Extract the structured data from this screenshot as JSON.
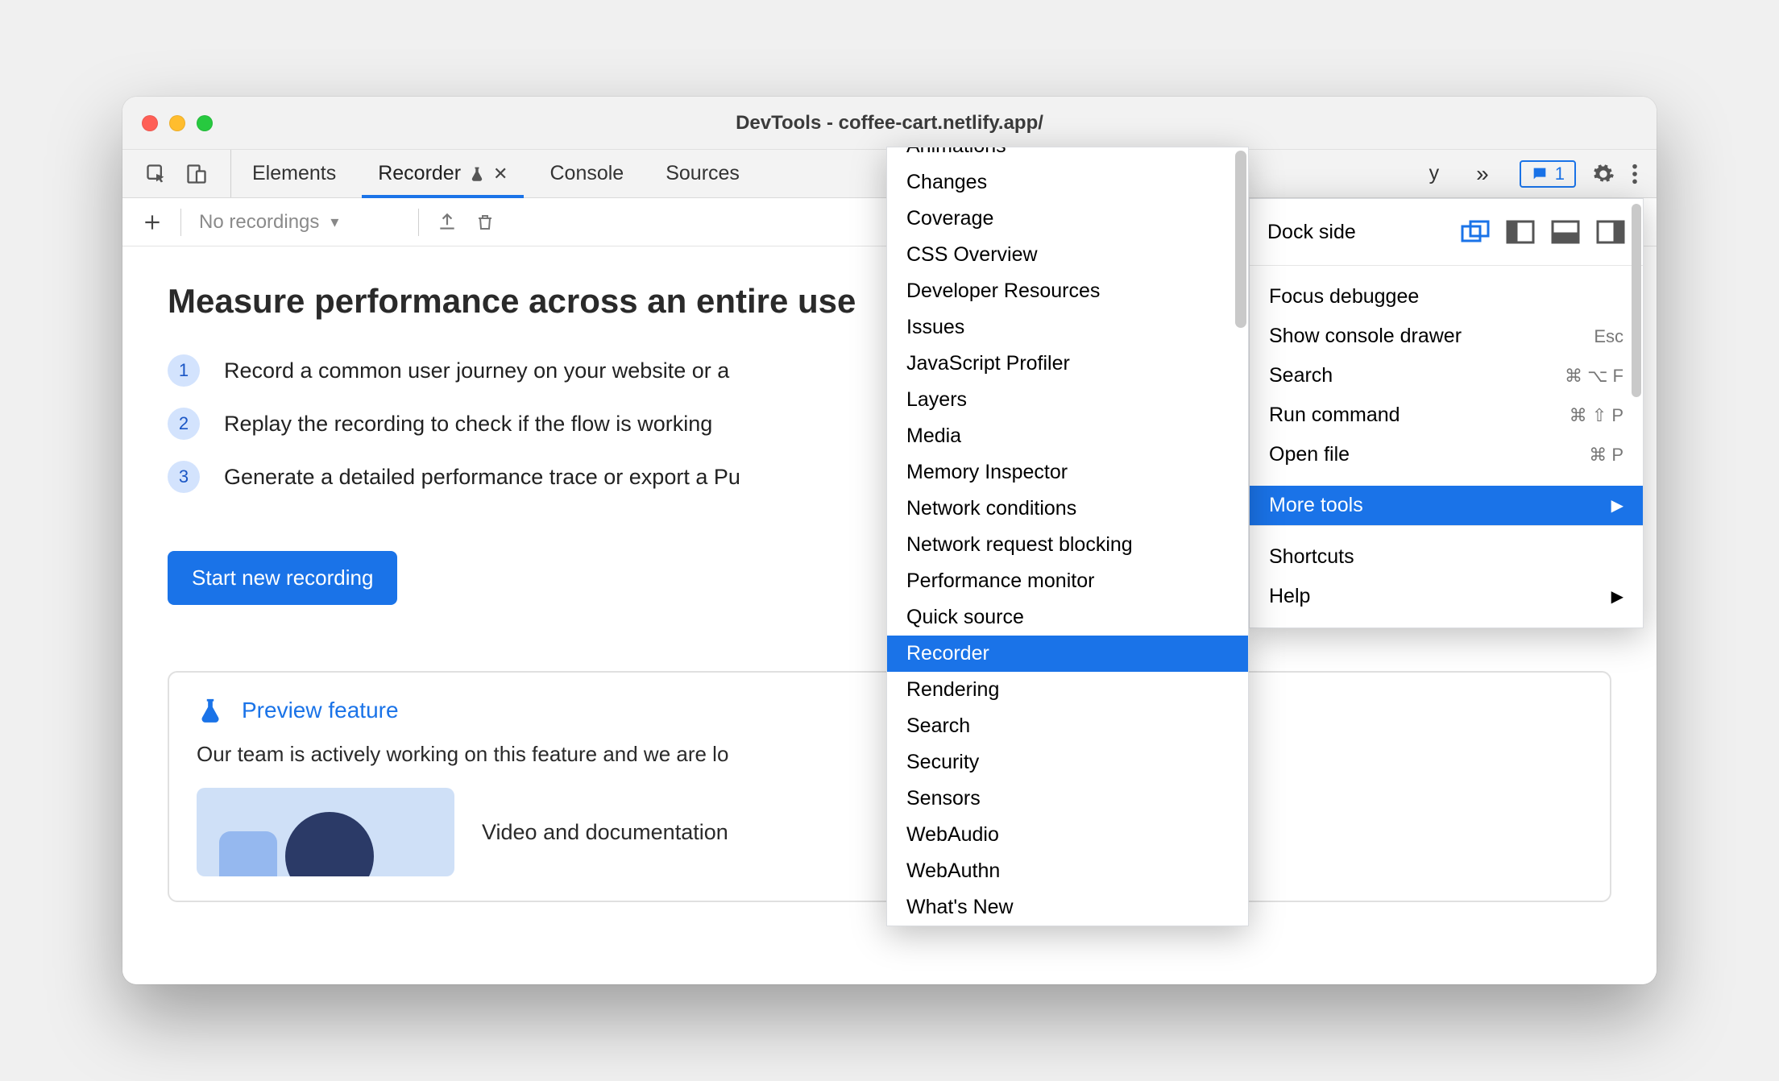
{
  "window": {
    "title": "DevTools - coffee-cart.netlify.app/"
  },
  "tabs": {
    "items": [
      "Elements",
      "Recorder",
      "Console",
      "Sources"
    ],
    "active": "Recorder",
    "truncated_suffix": "y",
    "overflow_glyph": "»"
  },
  "issues_badge": "1",
  "subtoolbar": {
    "add_tooltip": "New recording",
    "dropdown_placeholder": "No recordings"
  },
  "recorder": {
    "heading": "Measure performance across an entire user journey",
    "heading_visible": "Measure performance across an entire use",
    "steps": [
      "Record a common user journey on your website or app",
      "Replay the recording to check if the flow is working",
      "Generate a detailed performance trace or export a Puppeteer script"
    ],
    "steps_visible": [
      "Record a common user journey on your website or a",
      "Replay the recording to check if the flow is working",
      "Generate a detailed performance trace or export a Pu"
    ],
    "button": "Start new recording",
    "preview": {
      "title": "Preview feature",
      "body": "Our team is actively working on this feature and we are looking for your feedback!",
      "body_visible": "Our team is actively working on this feature and we are lo",
      "media_title": "Video and documentation"
    }
  },
  "mainmenu": {
    "dock_label": "Dock side",
    "items_a": [
      {
        "label": "Focus debuggee",
        "shortcut": ""
      },
      {
        "label": "Show console drawer",
        "shortcut": "Esc"
      },
      {
        "label": "Search",
        "shortcut": "⌘ ⌥ F"
      },
      {
        "label": "Run command",
        "shortcut": "⌘ ⇧ P"
      },
      {
        "label": "Open file",
        "shortcut": "⌘ P"
      }
    ],
    "more_tools_label": "More tools",
    "items_b": [
      {
        "label": "Shortcuts",
        "shortcut": ""
      },
      {
        "label": "Help",
        "shortcut": "",
        "submenu": true
      }
    ]
  },
  "more_tools_submenu": {
    "items": [
      "Animations",
      "Changes",
      "Coverage",
      "CSS Overview",
      "Developer Resources",
      "Issues",
      "JavaScript Profiler",
      "Layers",
      "Media",
      "Memory Inspector",
      "Network conditions",
      "Network request blocking",
      "Performance monitor",
      "Quick source",
      "Recorder",
      "Rendering",
      "Search",
      "Security",
      "Sensors",
      "WebAudio",
      "WebAuthn",
      "What's New"
    ],
    "selected": "Recorder"
  }
}
